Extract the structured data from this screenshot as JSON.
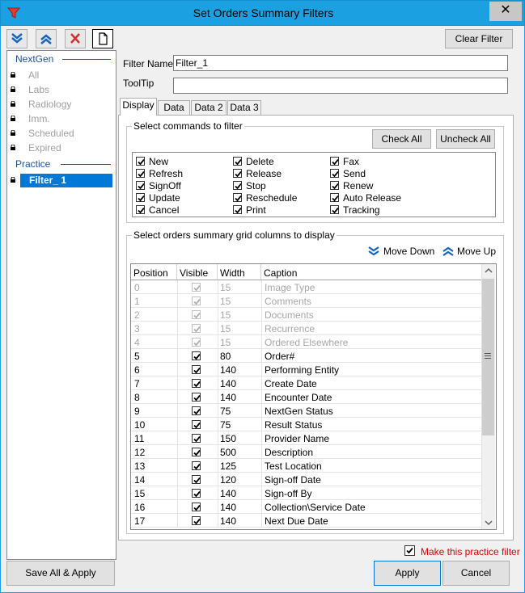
{
  "window": {
    "title": "Set Orders Summary Filters",
    "close_glyph": "✕"
  },
  "toolbar": {
    "icons": [
      "move-down-icon",
      "move-up-icon",
      "delete-icon",
      "new-document-icon"
    ],
    "clear_filter_label": "Clear Filter"
  },
  "tree": {
    "groups": [
      {
        "header": "NextGen",
        "items": [
          "All",
          "Labs",
          "Radiology",
          "Imm.",
          "Scheduled",
          "Expired"
        ]
      },
      {
        "header": "Practice",
        "items": [
          "Filter_ 1"
        ],
        "selected": "Filter_ 1"
      }
    ]
  },
  "form": {
    "filter_name_label": "Filter Name",
    "filter_name_value": "Filter_1",
    "tooltip_label": "ToolTip",
    "tooltip_value": ""
  },
  "tabs": [
    "Display",
    "Data",
    "Data 2",
    "Data 3"
  ],
  "active_tab": "Display",
  "commands": {
    "group_title": "Select commands to filter",
    "check_all_label": "Check All",
    "uncheck_all_label": "Uncheck All",
    "columns": [
      [
        "New",
        "Refresh",
        "SignOff",
        "Update",
        "Cancel"
      ],
      [
        "Delete",
        "Release",
        "Stop",
        "Reschedule",
        "Print"
      ],
      [
        "Fax",
        "Send",
        "Renew",
        "Auto Release",
        "Tracking"
      ]
    ]
  },
  "grid_section": {
    "group_title": "Select orders summary grid columns to display",
    "move_down_label": "Move Down",
    "move_up_label": "Move Up",
    "headers": [
      "Position",
      "Visible",
      "Width",
      "Caption"
    ],
    "rows": [
      {
        "position": "0",
        "visible": true,
        "width": "15",
        "caption": "Image Type",
        "disabled": true
      },
      {
        "position": "1",
        "visible": true,
        "width": "15",
        "caption": "Comments",
        "disabled": true
      },
      {
        "position": "2",
        "visible": true,
        "width": "15",
        "caption": "Documents",
        "disabled": true
      },
      {
        "position": "3",
        "visible": true,
        "width": "15",
        "caption": "Recurrence",
        "disabled": true
      },
      {
        "position": "4",
        "visible": true,
        "width": "15",
        "caption": "Ordered Elsewhere",
        "disabled": true
      },
      {
        "position": "5",
        "visible": true,
        "width": "80",
        "caption": "Order#",
        "disabled": false
      },
      {
        "position": "6",
        "visible": true,
        "width": "140",
        "caption": "Performing Entity",
        "disabled": false
      },
      {
        "position": "7",
        "visible": true,
        "width": "140",
        "caption": "Create Date",
        "disabled": false
      },
      {
        "position": "8",
        "visible": true,
        "width": "140",
        "caption": "Encounter Date",
        "disabled": false
      },
      {
        "position": "9",
        "visible": true,
        "width": "75",
        "caption": "NextGen Status",
        "disabled": false
      },
      {
        "position": "10",
        "visible": true,
        "width": "75",
        "caption": "Result Status",
        "disabled": false
      },
      {
        "position": "11",
        "visible": true,
        "width": "150",
        "caption": "Provider Name",
        "disabled": false
      },
      {
        "position": "12",
        "visible": true,
        "width": "500",
        "caption": "Description",
        "disabled": false
      },
      {
        "position": "13",
        "visible": true,
        "width": "125",
        "caption": "Test Location",
        "disabled": false
      },
      {
        "position": "14",
        "visible": true,
        "width": "120",
        "caption": "Sign-off Date",
        "disabled": false
      },
      {
        "position": "15",
        "visible": true,
        "width": "140",
        "caption": "Sign-off By",
        "disabled": false
      },
      {
        "position": "16",
        "visible": true,
        "width": "140",
        "caption": "Collection\\Service Date",
        "disabled": false
      },
      {
        "position": "17",
        "visible": true,
        "width": "140",
        "caption": "Next Due Date",
        "disabled": false
      }
    ]
  },
  "footer": {
    "practice_filter_label": "Make this practice filter",
    "practice_filter_checked": true,
    "save_all_label": "Save All & Apply",
    "apply_label": "Apply",
    "cancel_label": "Cancel"
  },
  "colors": {
    "titlebar": "#1ba1e2",
    "selection": "#0078d7",
    "accent_red": "#e00000",
    "group_header": "#1f4e9e"
  }
}
